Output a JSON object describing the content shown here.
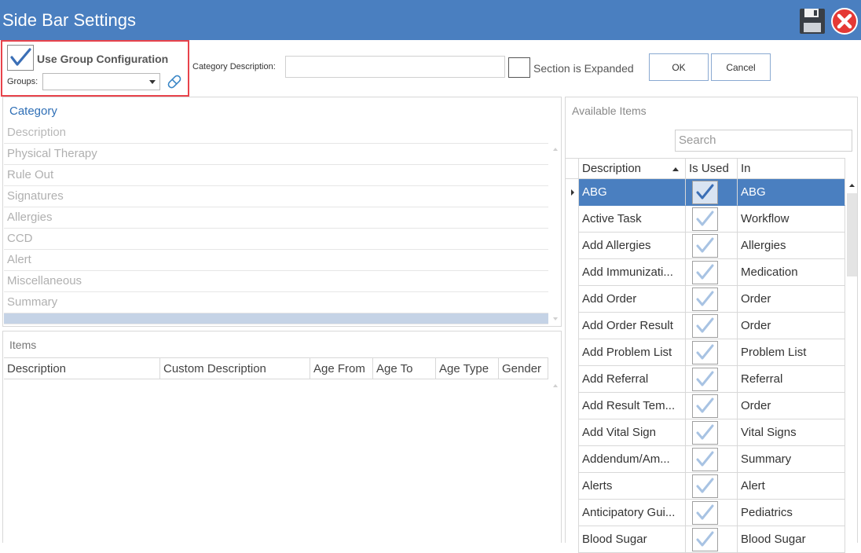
{
  "window": {
    "title": "Side Bar Settings"
  },
  "group_config": {
    "use_group_label": "Use Group Configuration",
    "use_group_checked": true,
    "groups_label": "Groups:",
    "groups_value": ""
  },
  "category_description": {
    "label": "Category Description:",
    "value": "",
    "section_expanded_label": "Section is Expanded",
    "section_expanded_checked": false
  },
  "buttons": {
    "ok": "OK",
    "cancel": "Cancel"
  },
  "category_panel": {
    "title": "Category",
    "column_header": "Description",
    "rows": [
      "Physical Therapy",
      "Rule Out",
      "Signatures",
      "Allergies",
      "CCD",
      "Alert",
      "Miscellaneous",
      "Summary",
      ""
    ]
  },
  "items_panel": {
    "title": "Items",
    "columns": [
      "Description",
      "Custom Description",
      "Age From",
      "Age To",
      "Age Type",
      "Gender"
    ]
  },
  "available_items": {
    "title": "Available Items",
    "search_placeholder": "Search",
    "columns": [
      "Description",
      "Is Used",
      "In"
    ],
    "sort_column": "Description",
    "sort_direction": "asc",
    "rows": [
      {
        "description": "ABG",
        "is_used": true,
        "in": "ABG",
        "selected": true
      },
      {
        "description": "Active Task",
        "is_used": true,
        "in": "Workflow"
      },
      {
        "description": "Add Allergies",
        "is_used": true,
        "in": "Allergies"
      },
      {
        "description": "Add Immunizati...",
        "is_used": true,
        "in": "Medication"
      },
      {
        "description": "Add Order",
        "is_used": true,
        "in": "Order"
      },
      {
        "description": "Add Order Result",
        "is_used": true,
        "in": "Order"
      },
      {
        "description": "Add Problem List",
        "is_used": true,
        "in": "Problem List"
      },
      {
        "description": "Add Referral",
        "is_used": true,
        "in": "Referral"
      },
      {
        "description": "Add Result Tem...",
        "is_used": true,
        "in": "Order"
      },
      {
        "description": "Add Vital Sign",
        "is_used": true,
        "in": "Vital Signs"
      },
      {
        "description": "Addendum/Am...",
        "is_used": true,
        "in": "Summary"
      },
      {
        "description": "Alerts",
        "is_used": true,
        "in": "Alert"
      },
      {
        "description": "Anticipatory Gui...",
        "is_used": true,
        "in": "Pediatrics"
      },
      {
        "description": "Blood Sugar",
        "is_used": true,
        "in": "Blood Sugar"
      }
    ]
  },
  "colors": {
    "title_bar": "#4a7fc0",
    "highlight_border": "#e8434b",
    "selected_row": "#4a7fc0",
    "category_title": "#2f6fb6"
  }
}
